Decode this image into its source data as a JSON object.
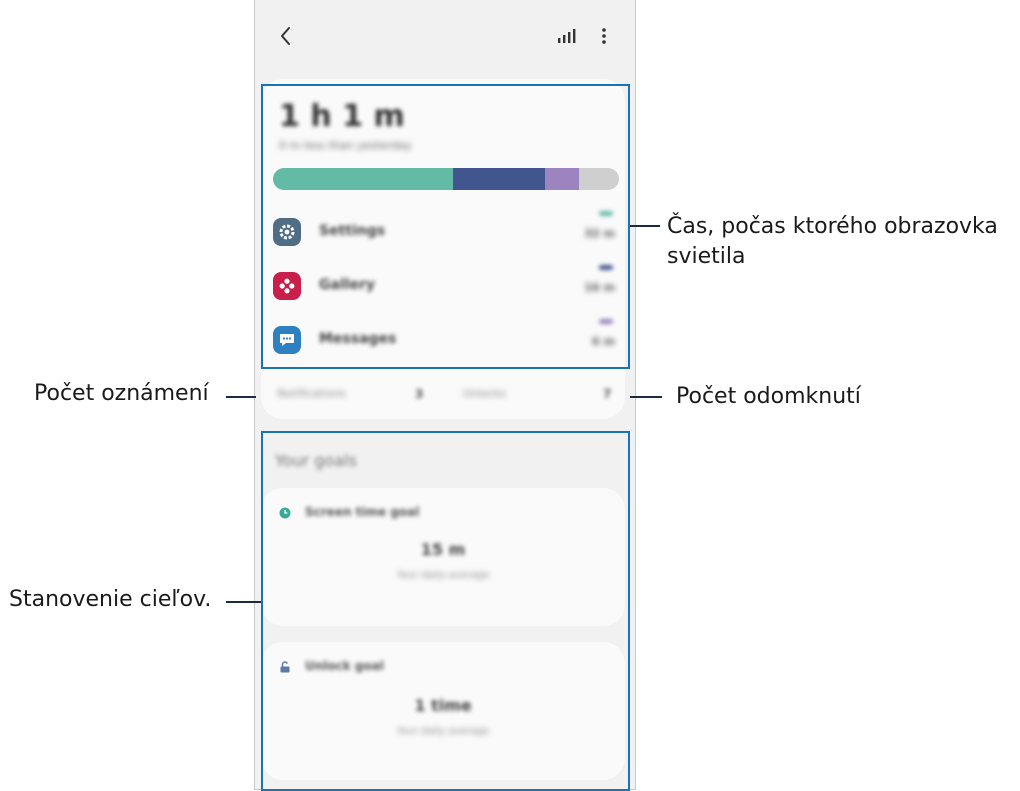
{
  "summary": {
    "total_time": "1 h 1 m",
    "compare_text": "0 m less than yesterday",
    "usage_segments": [
      {
        "app": "Settings",
        "color": "#63bba5",
        "fraction": 0.52
      },
      {
        "app": "Gallery",
        "color": "#41558f",
        "fraction": 0.265
      },
      {
        "app": "Messages",
        "color": "#9b84bf",
        "fraction": 0.1
      },
      {
        "app": "Other",
        "color": "#cfcfcf",
        "fraction": 0.115
      }
    ]
  },
  "apps": [
    {
      "name": "Settings",
      "time": "32 m",
      "color": "#63bba5",
      "icon": "gear-icon",
      "icon_bg": "#4f6d84"
    },
    {
      "name": "Gallery",
      "time": "16 m",
      "color": "#41558f",
      "icon": "flower-icon",
      "icon_bg": "#c8204a"
    },
    {
      "name": "Messages",
      "time": "6 m",
      "color": "#9b84bf",
      "icon": "chat-bubble-icon",
      "icon_bg": "#2f80c0"
    }
  ],
  "stats": {
    "notifications_label": "Notifications",
    "notifications_value": "3",
    "unlocks_label": "Unlocks",
    "unlocks_value": "7"
  },
  "goals": {
    "section_title": "Your goals",
    "screen_time": {
      "name": "Screen time goal",
      "value": "15 m",
      "sub": "Your daily average",
      "icon": "clock-icon"
    },
    "unlock": {
      "name": "Unlock goal",
      "value": "1 time",
      "sub": "Your daily average",
      "icon": "unlock-icon"
    }
  },
  "callouts": {
    "screen_time": "Čas, počas ktorého obrazovka svietila",
    "notifications": "Počet oznámení",
    "unlocks": "Počet odomknutí",
    "goals": "Stanovenie cieľov."
  },
  "colors": {
    "highlight": "#1a73b8",
    "leader": "#1a2a44"
  }
}
